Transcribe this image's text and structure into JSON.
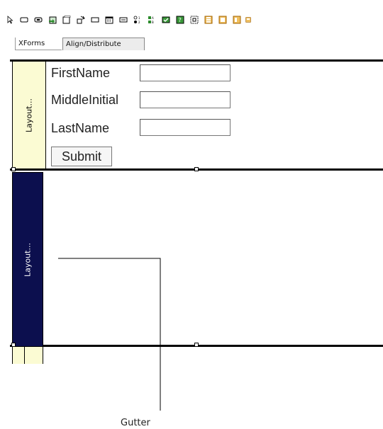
{
  "toolbar": {
    "icons": [
      "pointer-icon",
      "rectangle-button-icon",
      "button-icon",
      "image-icon",
      "box-icon",
      "select-icon",
      "textbox-icon",
      "date-icon",
      "ellipsis-icon",
      "radio-icon",
      "list-icon",
      "checkbox-icon",
      "help-icon",
      "frame-icon",
      "panel-icon",
      "panel-icon-2",
      "panel-icon-3",
      "panel-icon-4"
    ]
  },
  "tabs": [
    {
      "label": "XForms"
    },
    {
      "label": "Align/Distribute"
    }
  ],
  "layout": {
    "band1_gutter_label": "Layout...",
    "band2_gutter_label": "Layout..."
  },
  "form": {
    "fields": [
      {
        "label": "FirstName",
        "value": ""
      },
      {
        "label": "MiddleInitial",
        "value": ""
      },
      {
        "label": "LastName",
        "value": ""
      }
    ],
    "submit_label": "Submit"
  },
  "callout": {
    "label": "Gutter"
  }
}
